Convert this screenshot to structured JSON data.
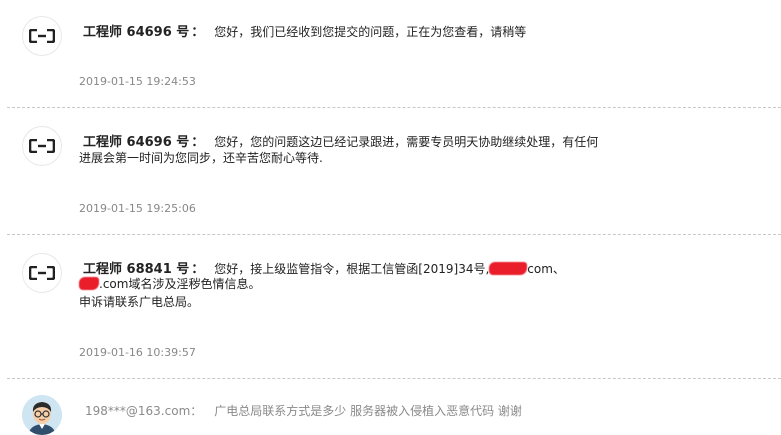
{
  "messages": [
    {
      "speaker": "工程师 64696 号",
      "colon": "：",
      "line1": "您好，我们已经收到您提交的问题，正在为您查看，请稍等",
      "time": "2019-01-15 19:24:53"
    },
    {
      "speaker": "工程师 64696 号",
      "colon": "：",
      "line1": "您好，您的问题这边已经记录跟进，需要专员明天协助继续处理，有任何",
      "line2": "进展会第一时间为您同步，还辛苦您耐心等待.",
      "time": "2019-01-15 19:25:06"
    },
    {
      "speaker": "工程师 68841 号",
      "colon": "：",
      "line1_a": "您好，接上级监管指令，根据工信管函[2019]34号,",
      "line1_b": "com、",
      "line2_b": ".com域名涉及淫秽色情信息。",
      "line3": "申诉请联系广电总局。",
      "time": "2019-01-16 10:39:57"
    }
  ],
  "user_reply": {
    "username": "198***@163.com",
    "colon": "：",
    "text": "广电总局联系方式是多少 服务器被入侵植入恶意代码 谢谢"
  },
  "colors": {
    "redaction": "#ea1d2b",
    "timestamp": "#888888",
    "separator": "#c8c8c8"
  },
  "icons": {
    "agent_avatar": "aliyun-logo-icon",
    "user_avatar": "user-cartoon-avatar-icon"
  }
}
